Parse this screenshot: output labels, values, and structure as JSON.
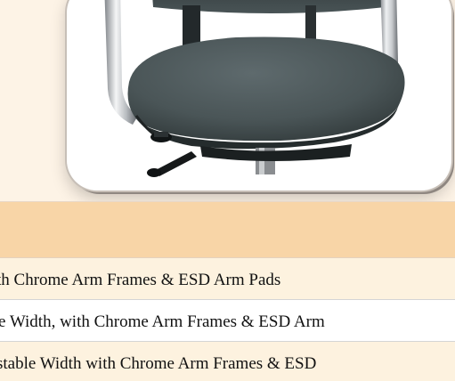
{
  "product": {
    "image_name": "ergonomic-chair-image"
  },
  "options_table": {
    "header": "",
    "rows": [
      {
        "text": "th Chrome Arm Frames & ESD Arm Pads"
      },
      {
        "text": "e Width, with Chrome Arm Frames & ESD Arm"
      },
      {
        "text": "stable Width with Chrome Arm Frames & ESD"
      }
    ]
  },
  "colors": {
    "panel_background": "#fdf3e6",
    "header_background": "#f8d5a7",
    "row_highlight": "#fdf2df",
    "seat_fabric": "#4b5658",
    "chrome": "#d6d8da"
  }
}
